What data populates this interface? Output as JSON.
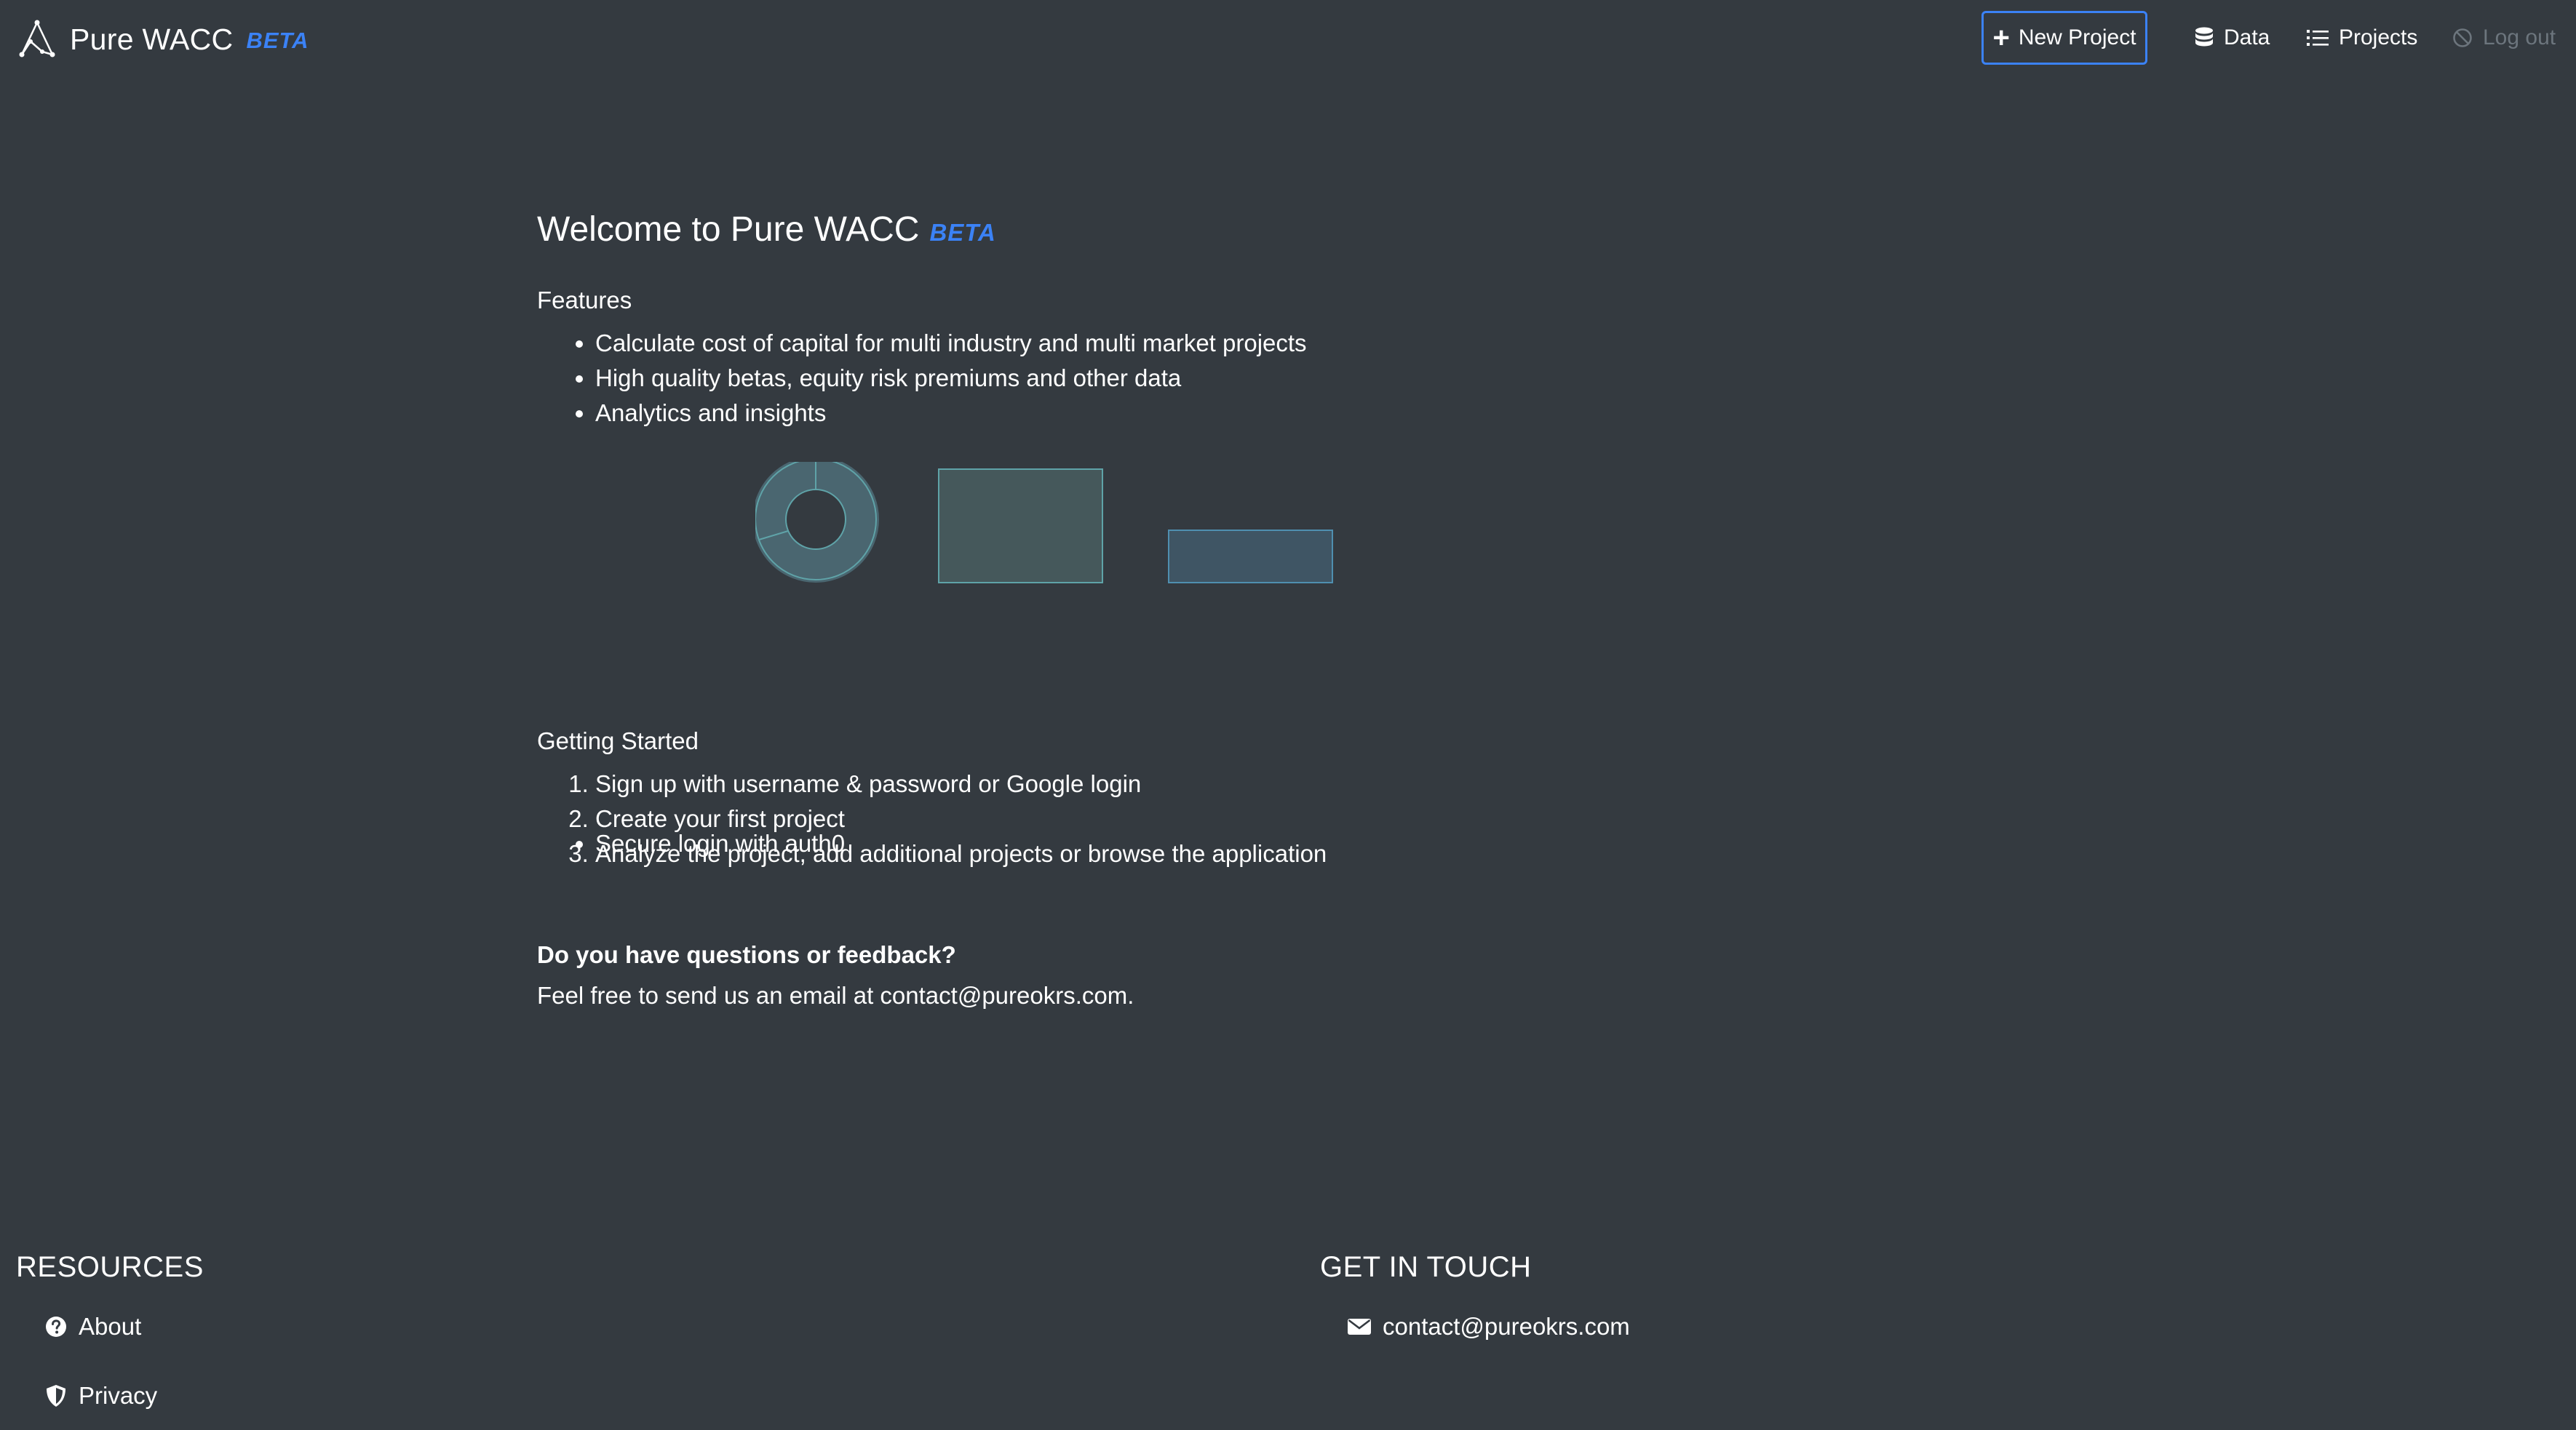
{
  "navbar": {
    "brand_name": "Pure WACC",
    "brand_beta": "BETA",
    "new_project_label": "New Project",
    "data_label": "Data",
    "projects_label": "Projects",
    "logout_label": "Log out"
  },
  "main": {
    "welcome_title": "Welcome to Pure WACC",
    "welcome_beta": "BETA",
    "features_title": "Features",
    "features": [
      "Calculate cost of capital for multi industry and multi market projects",
      "High quality betas, equity risk premiums and other data",
      "Analytics and insights"
    ],
    "secure_feature": "Secure login with auth0",
    "getting_started_title": "Getting Started",
    "getting_started_steps": [
      "Sign up with username & password or Google login",
      "Create your first project",
      "Analyze the project, add additional projects or browse the application"
    ],
    "questions_title": "Do you have questions or feedback?",
    "questions_text": "Feel free to send us an email at contact@pureokrs.com."
  },
  "footer": {
    "resources_heading": "RESOURCES",
    "about_label": "About",
    "privacy_label": "Privacy",
    "get_in_touch_heading": "GET IN TOUCH",
    "contact_email": "contact@pureokrs.com"
  },
  "icons": {
    "brand": "network-triangle-icon",
    "new_project": "plus-icon",
    "data": "database-icon",
    "projects": "list-icon",
    "logout": "ban-icon",
    "about": "question-circle-icon",
    "privacy": "shield-icon",
    "contact": "envelope-icon"
  },
  "colors": {
    "background": "#343a40",
    "accent": "#3b82f6",
    "text": "#ffffff",
    "muted": "#6c757d"
  }
}
